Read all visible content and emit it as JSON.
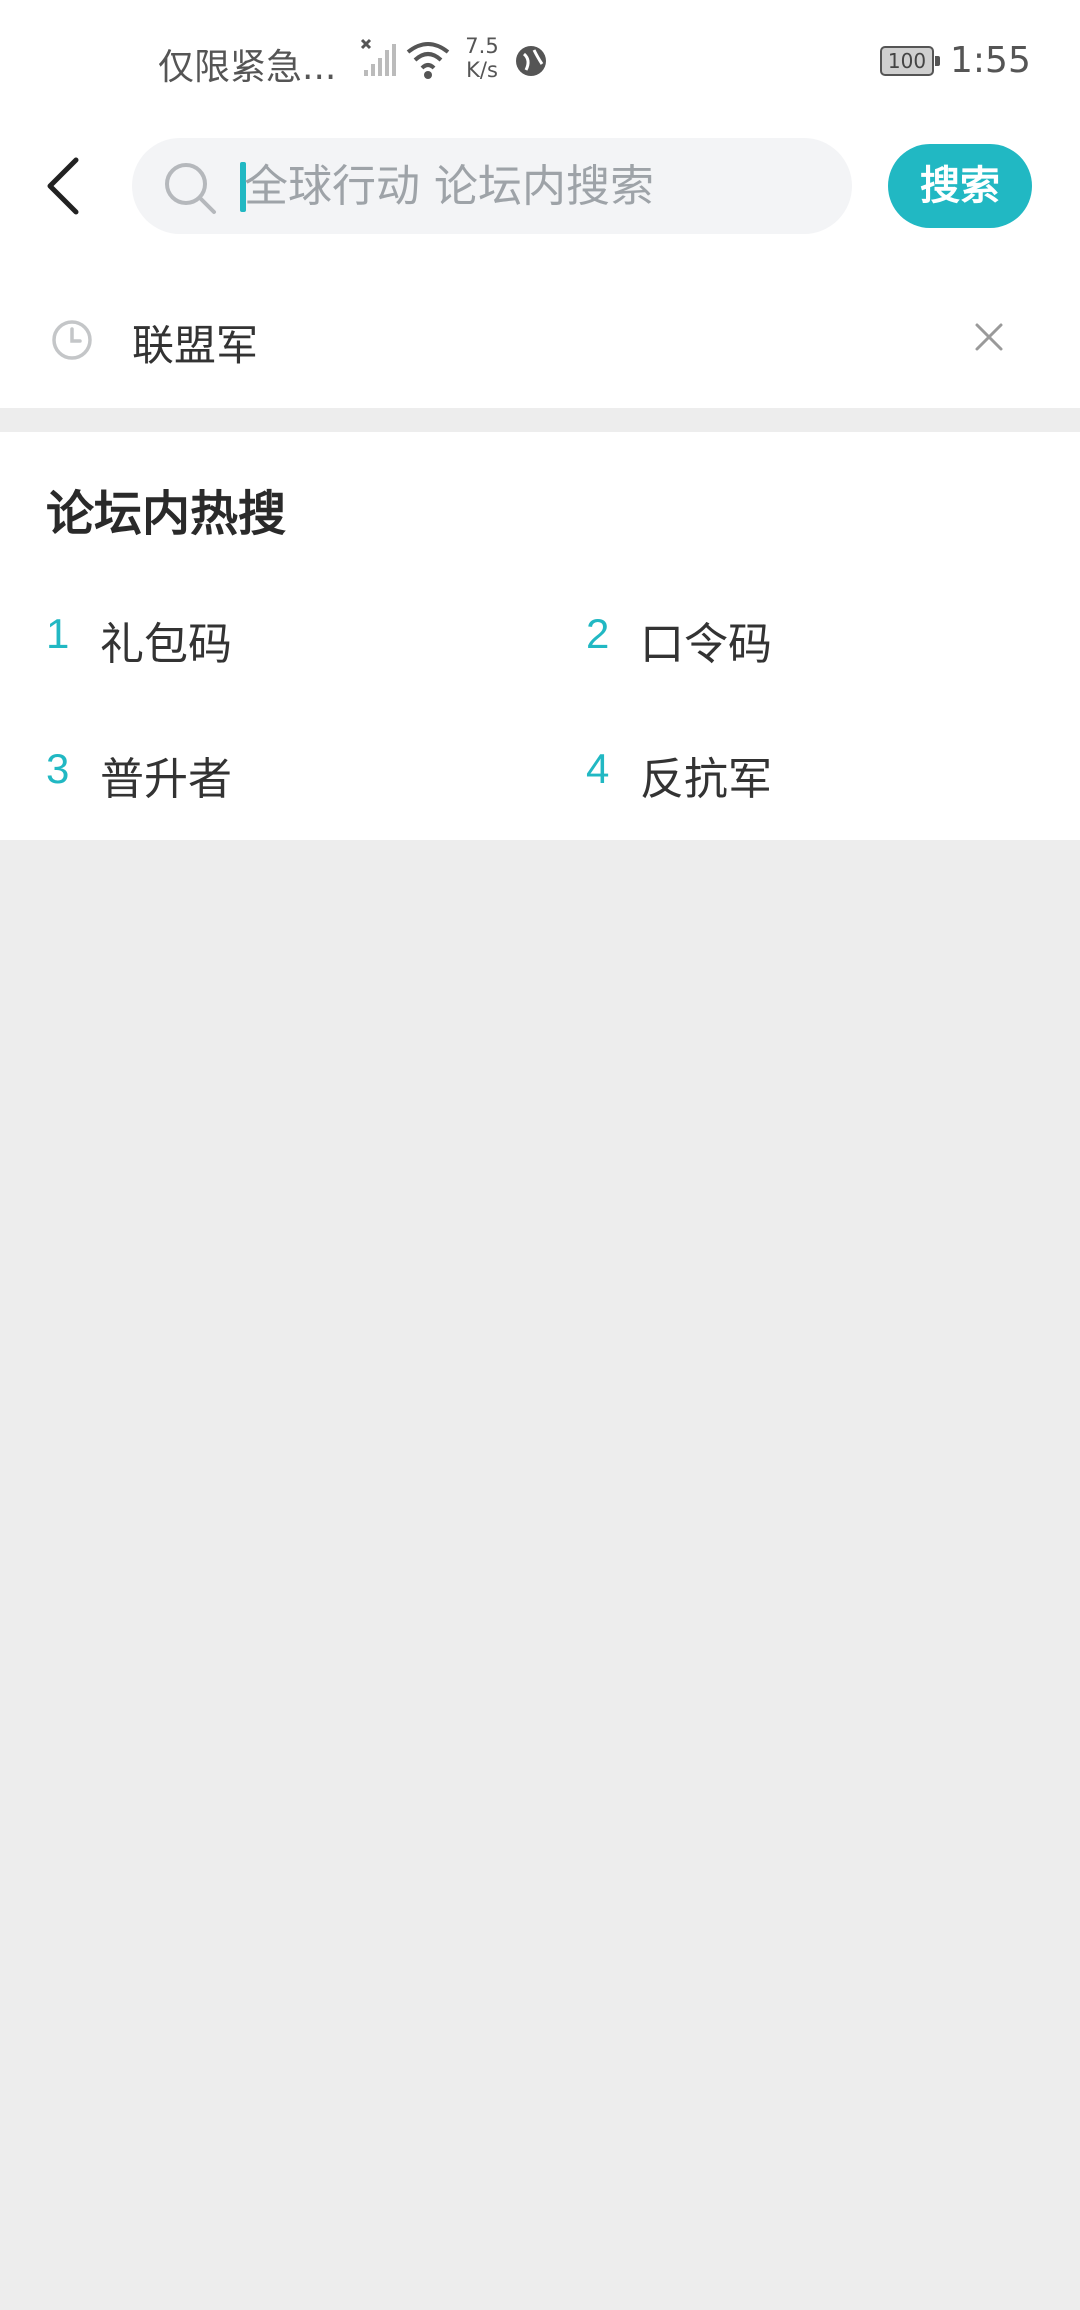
{
  "status_bar": {
    "carrier": "仅限紧急...",
    "speed_value": "7.5",
    "speed_unit": "K/s",
    "battery": "100",
    "time": "1:55"
  },
  "search": {
    "placeholder": "全球行动 论坛内搜索",
    "value": "",
    "button_label": "搜索"
  },
  "history": {
    "items": [
      {
        "label": "联盟军"
      }
    ]
  },
  "hot_search": {
    "title": "论坛内热搜",
    "items": [
      {
        "rank": "1",
        "label": "礼包码"
      },
      {
        "rank": "2",
        "label": "口令码"
      },
      {
        "rank": "3",
        "label": "普升者"
      },
      {
        "rank": "4",
        "label": "反抗军"
      }
    ]
  },
  "icons": {
    "back": "chevron-left-icon",
    "search": "search-icon",
    "history": "clock-icon",
    "delete": "close-icon"
  },
  "colors": {
    "accent": "#21b8c3",
    "background": "#ededed",
    "surface": "#ffffff",
    "search_box": "#f3f4f6"
  }
}
